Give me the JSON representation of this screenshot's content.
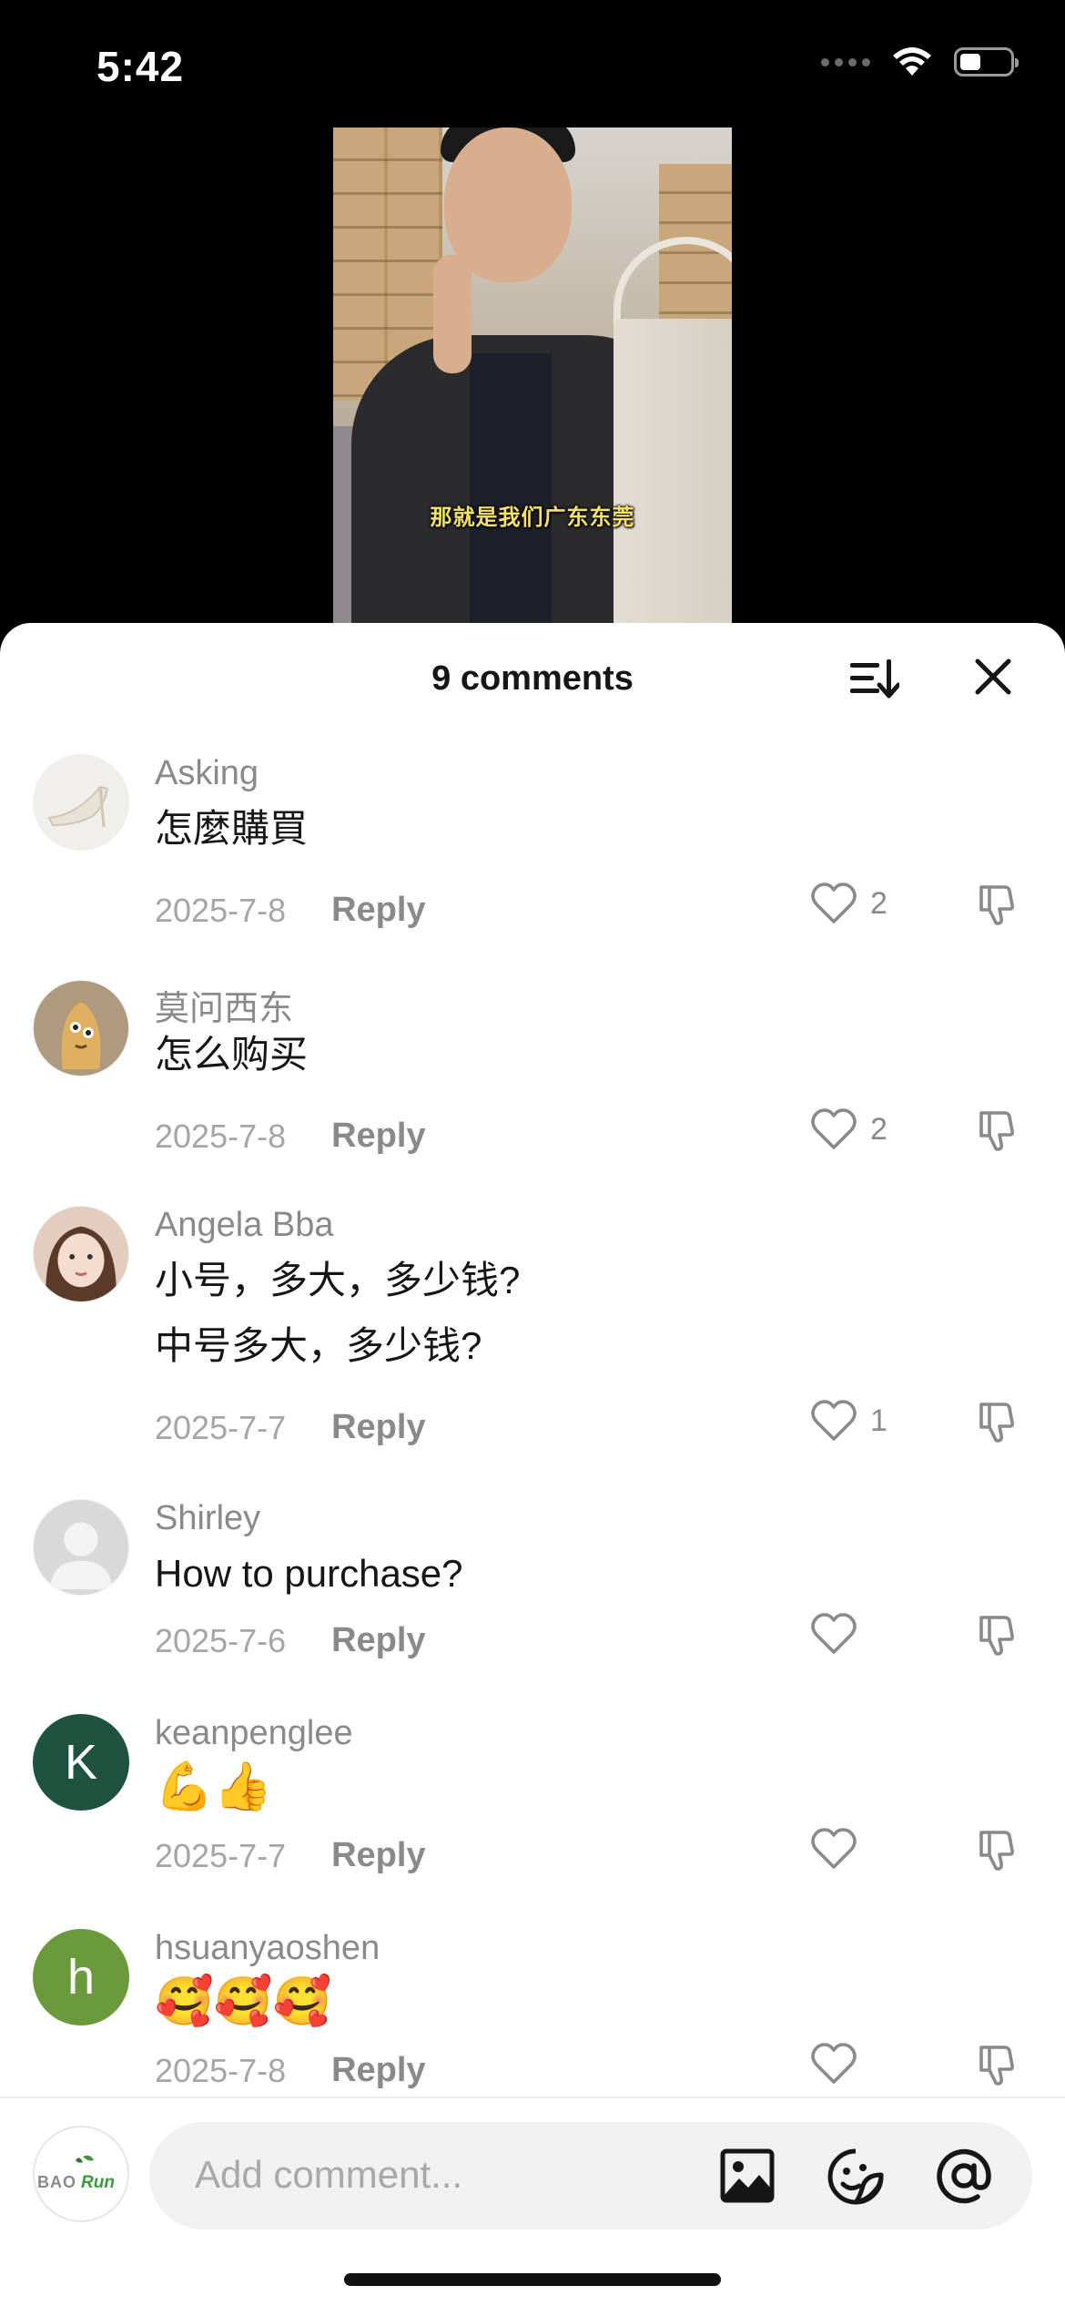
{
  "status_bar": {
    "time": "5:42"
  },
  "video": {
    "caption": "那就是我们广东东莞"
  },
  "sheet": {
    "title": "9 comments",
    "sort_icon": "sort-icon",
    "close_icon": "close-icon"
  },
  "comments": [
    {
      "username": "Asking",
      "lines": [
        "怎麼購買"
      ],
      "date": "2025-7-8",
      "reply_label": "Reply",
      "likes": "2",
      "avatar": "shoe-photo"
    },
    {
      "username": "莫问西东",
      "lines": [
        "怎么购买"
      ],
      "date": "2025-7-8",
      "reply_label": "Reply",
      "likes": "2",
      "avatar": "cartoon-character"
    },
    {
      "username": "Angela Bba",
      "lines": [
        "小号，多大，多少钱?",
        "中号多大，多少钱?"
      ],
      "date": "2025-7-7",
      "reply_label": "Reply",
      "likes": "1",
      "avatar": "woman-photo"
    },
    {
      "username": "Shirley",
      "lines": [
        "How to purchase?"
      ],
      "date": "2025-7-6",
      "reply_label": "Reply",
      "likes": "",
      "avatar": "default-avatar"
    },
    {
      "username": "keanpenglee",
      "lines": [
        "💪👍"
      ],
      "date": "2025-7-7",
      "reply_label": "Reply",
      "likes": "",
      "avatar": "letter-K",
      "avatar_letter": "K",
      "avatar_color": "#1f5340"
    },
    {
      "username": "hsuanyaoshen",
      "lines": [
        "🥰🥰🥰"
      ],
      "date": "2025-7-8",
      "reply_label": "Reply",
      "likes": "",
      "avatar": "letter-h",
      "avatar_letter": "h",
      "avatar_color": "#6a9a3c"
    }
  ],
  "composer": {
    "placeholder": "Add comment...",
    "my_avatar": {
      "logo_left": "BAO",
      "logo_right": "Run"
    },
    "icons": [
      "image-icon",
      "sticker-icon",
      "mention-icon"
    ]
  }
}
